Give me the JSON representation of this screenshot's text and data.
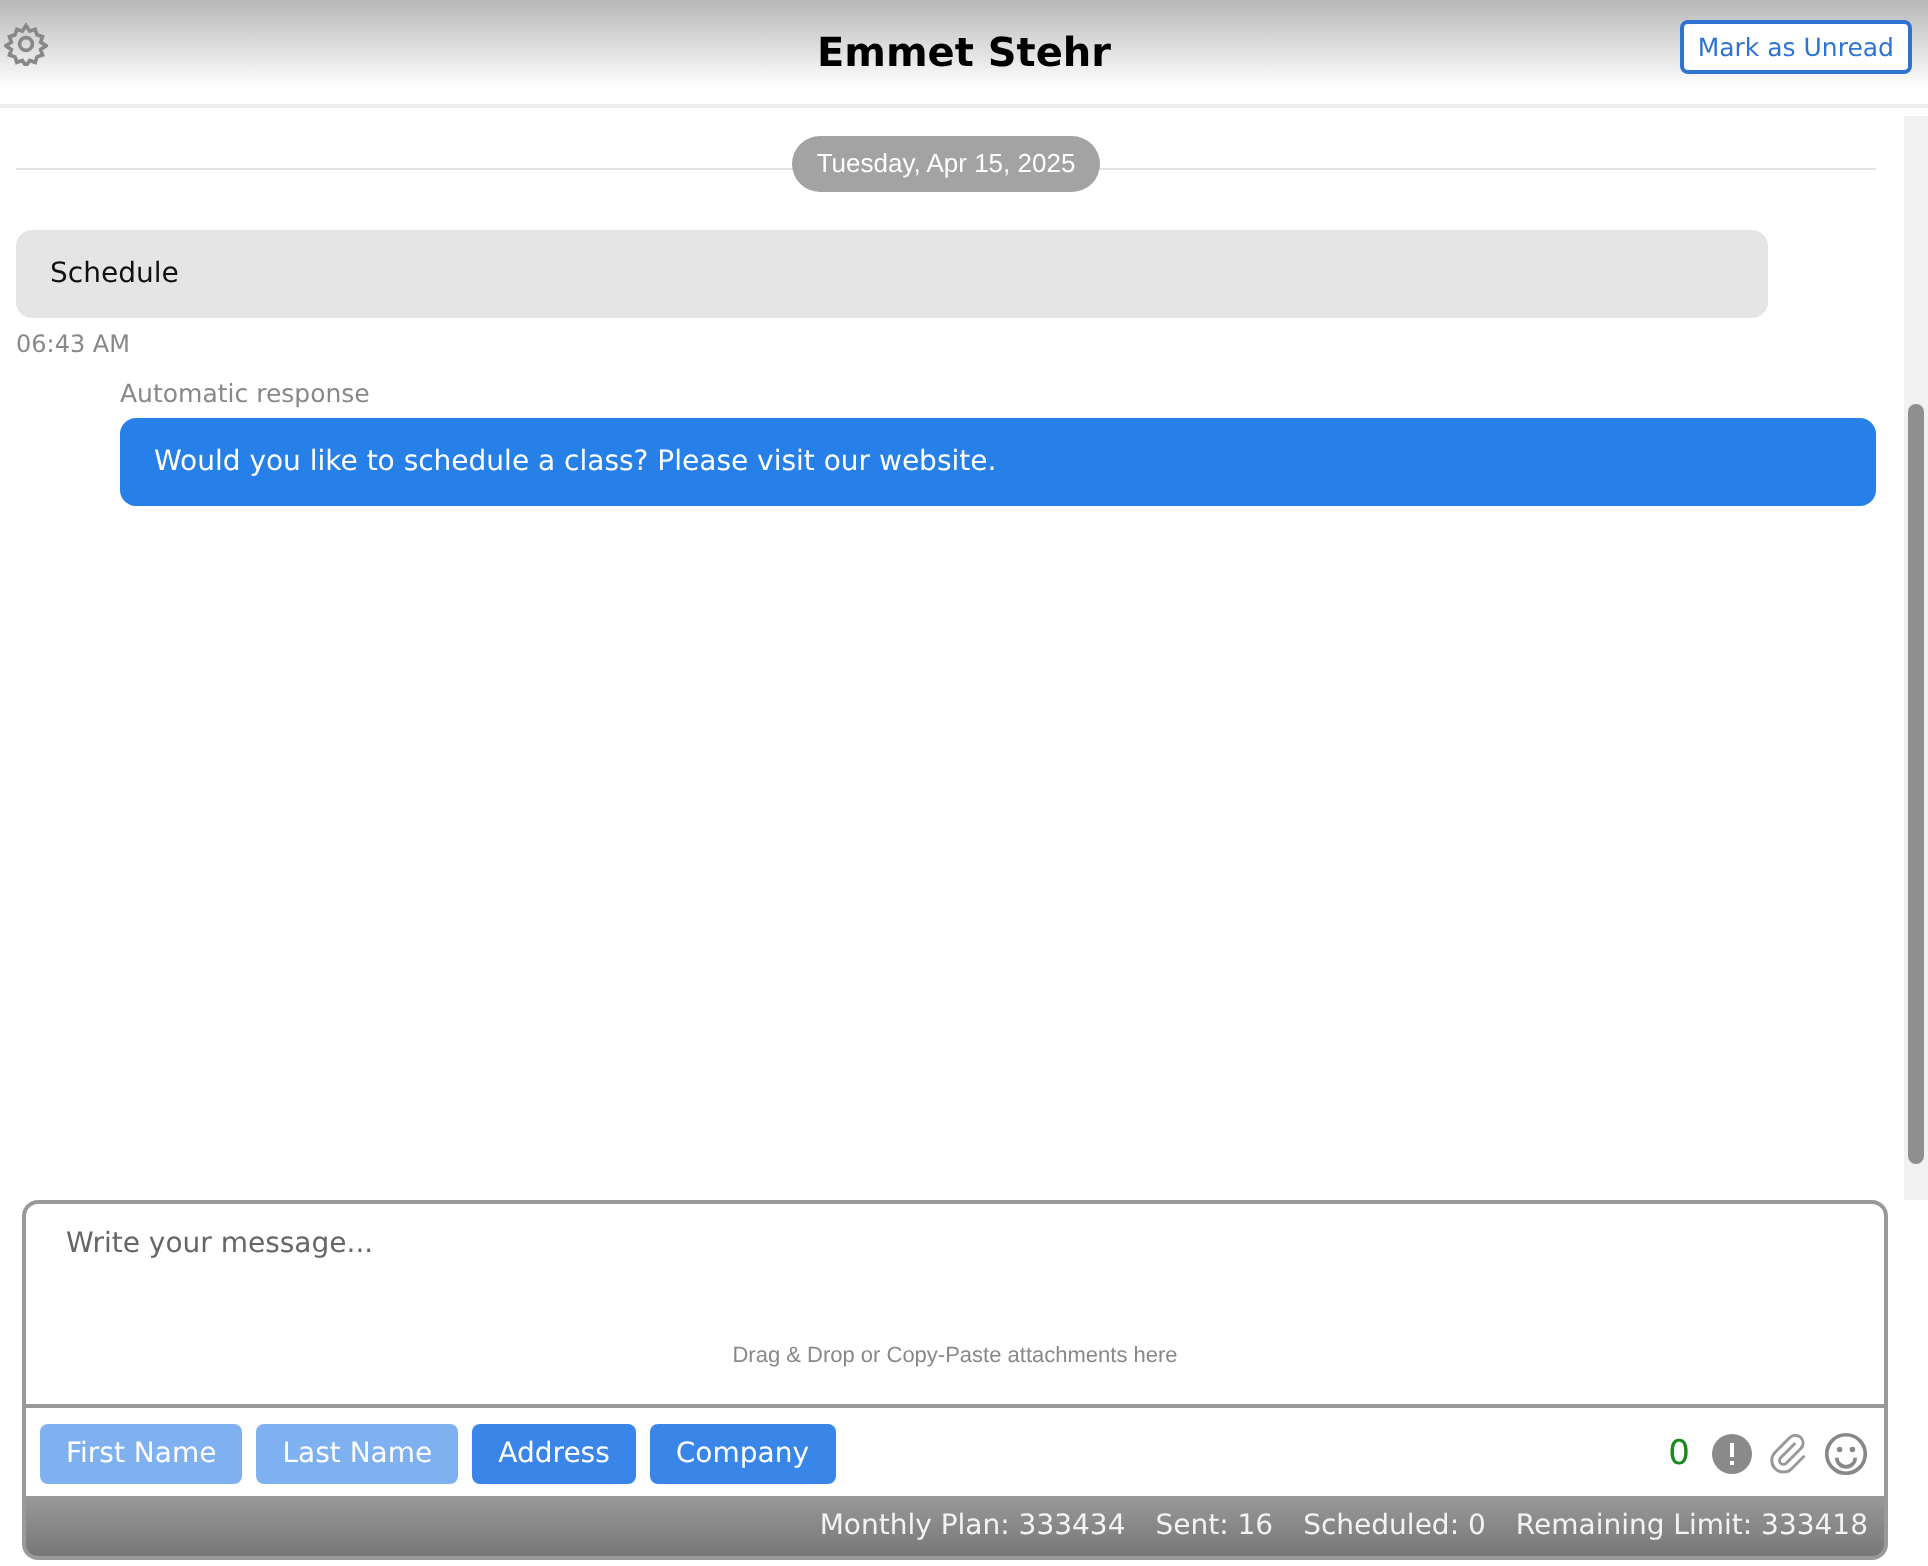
{
  "header": {
    "title": "Emmet Stehr",
    "action": "Mark as Unread"
  },
  "date_divider": "Tuesday, Apr 15, 2025",
  "messages": [
    {
      "kind": "incoming",
      "text": "Schedule",
      "time": "06:43 AM"
    },
    {
      "kind": "outgoing",
      "label": "Automatic response",
      "text": "Would you like to schedule a class? Please visit our website."
    }
  ],
  "composer": {
    "placeholder": "Write your message...",
    "drop_hint": "Drag & Drop or Copy-Paste attachments here",
    "fields": [
      {
        "label": "First Name",
        "disabled": true
      },
      {
        "label": "Last Name",
        "disabled": true
      },
      {
        "label": "Address",
        "disabled": false
      },
      {
        "label": "Company",
        "disabled": false
      }
    ],
    "char_count": "0"
  },
  "status_bar": [
    "Monthly Plan: 333434",
    "Sent: 16",
    "Scheduled: 0",
    "Remaining Limit: 333418"
  ]
}
